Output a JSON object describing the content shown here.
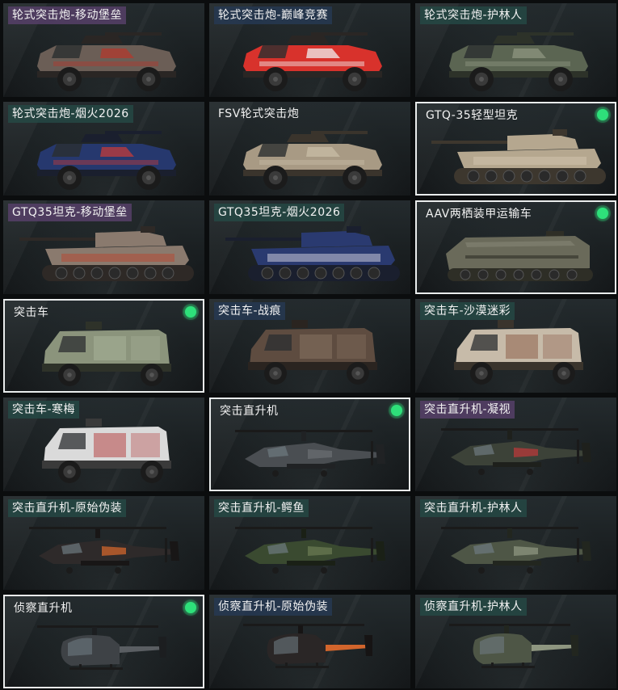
{
  "cards": [
    {
      "label": "轮式突击炮-移动堡垒",
      "tag": "purple",
      "selected": false,
      "owned": false,
      "vehicle": "wheeled-assault-gun",
      "body": "#6b5e56",
      "accent": "#b23a2e",
      "dark": "#2a2624"
    },
    {
      "label": "轮式突击炮-巅峰竞赛",
      "tag": "blue",
      "selected": false,
      "owned": false,
      "vehicle": "wheeled-assault-gun",
      "body": "#d8322c",
      "accent": "#f0f0f0",
      "dark": "#2a2624"
    },
    {
      "label": "轮式突击炮-护林人",
      "tag": "teal",
      "selected": false,
      "owned": false,
      "vehicle": "wheeled-assault-gun",
      "body": "#5b6552",
      "accent": "#8e9680",
      "dark": "#2d3229"
    },
    {
      "label": "轮式突击炮-烟火2026",
      "tag": "teal",
      "selected": false,
      "owned": false,
      "vehicle": "wheeled-assault-gun",
      "body": "#26386e",
      "accent": "#c23b3b",
      "dark": "#1a1f2e"
    },
    {
      "label": "FSV轮式突击炮",
      "tag": "none",
      "selected": false,
      "owned": false,
      "vehicle": "wheeled-assault-gun",
      "body": "#a89a84",
      "accent": "#c8bca6",
      "dark": "#3a342c"
    },
    {
      "label": "GTQ-35轻型坦克",
      "tag": "none",
      "selected": true,
      "owned": true,
      "vehicle": "light-tank",
      "body": "#b5a78f",
      "accent": "#cfc3ad",
      "dark": "#3d372e"
    },
    {
      "label": "GTQ35坦克-移动堡垒",
      "tag": "purple",
      "selected": false,
      "owned": false,
      "vehicle": "light-tank",
      "body": "#8a7a6e",
      "accent": "#b54a36",
      "dark": "#2e2926"
    },
    {
      "label": "GTQ35坦克-烟火2026",
      "tag": "teal",
      "selected": false,
      "owned": false,
      "vehicle": "light-tank",
      "body": "#2a3a70",
      "accent": "#c8c8d8",
      "dark": "#1a1f2e"
    },
    {
      "label": "AAV两栖装甲运输车",
      "tag": "none",
      "selected": true,
      "owned": true,
      "vehicle": "amphibious-apc",
      "body": "#6a6a5a",
      "accent": "#858574",
      "dark": "#2e2e26"
    },
    {
      "label": "突击车",
      "tag": "none",
      "selected": true,
      "owned": true,
      "vehicle": "assault-vehicle",
      "body": "#8b947c",
      "accent": "#aab39a",
      "dark": "#2e3229"
    },
    {
      "label": "突击车-战痕",
      "tag": "blue",
      "selected": false,
      "owned": false,
      "vehicle": "assault-vehicle",
      "body": "#5e4c40",
      "accent": "#8a7564",
      "dark": "#2a2420"
    },
    {
      "label": "突击车-沙漠迷彩",
      "tag": "teal",
      "selected": false,
      "owned": false,
      "vehicle": "assault-vehicle",
      "body": "#c7bba9",
      "accent": "#8a5a44",
      "dark": "#3a342c"
    },
    {
      "label": "突击车-寒梅",
      "tag": "teal",
      "selected": false,
      "owned": false,
      "vehicle": "assault-vehicle",
      "body": "#dadada",
      "accent": "#b33a3a",
      "dark": "#3a3a3a"
    },
    {
      "label": "突击直升机",
      "tag": "none",
      "selected": true,
      "owned": true,
      "vehicle": "attack-helicopter",
      "body": "#4a4e52",
      "accent": "#6a6e72",
      "dark": "#202224"
    },
    {
      "label": "突击直升机-凝视",
      "tag": "purple",
      "selected": false,
      "owned": false,
      "vehicle": "attack-helicopter",
      "body": "#3c4238",
      "accent": "#b83a3a",
      "dark": "#1e201c"
    },
    {
      "label": "突击直升机-原始伪装",
      "tag": "teal",
      "selected": false,
      "owned": false,
      "vehicle": "attack-helicopter",
      "body": "#2e2a2a",
      "accent": "#d2652c",
      "dark": "#181616"
    },
    {
      "label": "突击直升机-鳄鱼",
      "tag": "teal",
      "selected": false,
      "owned": false,
      "vehicle": "attack-helicopter",
      "body": "#3a4a30",
      "accent": "#6a7a52",
      "dark": "#1a2016"
    },
    {
      "label": "突击直升机-护林人",
      "tag": "teal",
      "selected": false,
      "owned": false,
      "vehicle": "attack-helicopter",
      "body": "#4e5646",
      "accent": "#8e9680",
      "dark": "#22261f"
    },
    {
      "label": "侦察直升机",
      "tag": "none",
      "selected": true,
      "owned": true,
      "vehicle": "scout-helicopter",
      "body": "#3e4246",
      "accent": "#5a5e62",
      "dark": "#1c1e20"
    },
    {
      "label": "侦察直升机-原始伪装",
      "tag": "blue",
      "selected": false,
      "owned": false,
      "vehicle": "scout-helicopter",
      "body": "#2a2626",
      "accent": "#d2652c",
      "dark": "#161414"
    },
    {
      "label": "侦察直升机-护林人",
      "tag": "teal",
      "selected": false,
      "owned": false,
      "vehicle": "scout-helicopter",
      "body": "#4e5646",
      "accent": "#8e9680",
      "dark": "#22261f"
    }
  ]
}
